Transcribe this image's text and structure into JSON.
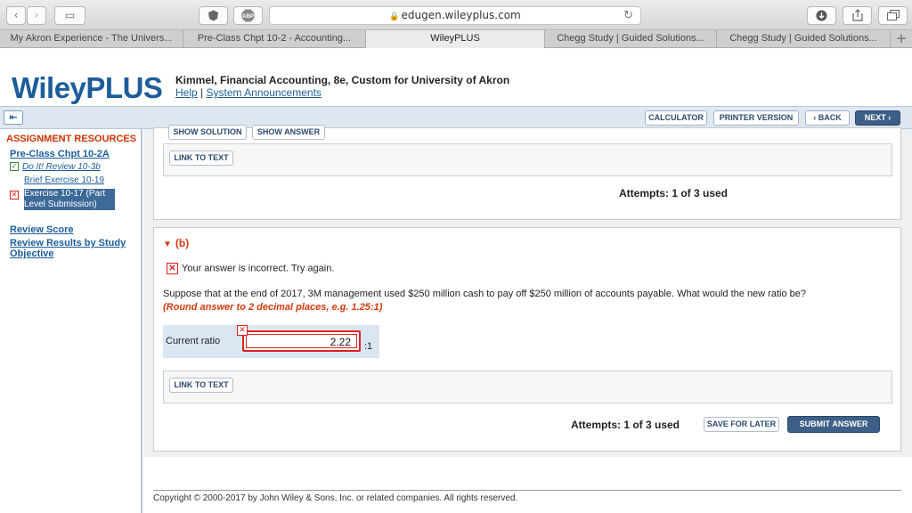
{
  "browser": {
    "url": "edugen.wileyplus.com",
    "tabs": [
      {
        "label": "My Akron Experience - The Univers..."
      },
      {
        "label": "Pre-Class Chpt 10-2 - Accounting..."
      },
      {
        "label": "WileyPLUS"
      },
      {
        "label": "Chegg Study | Guided Solutions..."
      },
      {
        "label": "Chegg Study | Guided Solutions..."
      }
    ],
    "back_icon": "‹",
    "forward_icon": "›",
    "sidebar_icon": "▭",
    "plus": "+"
  },
  "header": {
    "logo": "WileyPLUS",
    "course": "Kimmel, Financial Accounting, 8e, Custom for University of Akron",
    "help": "Help",
    "separator": "|",
    "announcements": "System Announcements"
  },
  "navbar": {
    "calculator": "CALCULATOR",
    "printer": "PRINTER VERSION",
    "back": "‹ BACK",
    "next": "NEXT ›"
  },
  "sidebar": {
    "title": "ASSIGNMENT RESOURCES",
    "section": "Pre-Class Chpt 10-2A",
    "items": [
      {
        "label": "Do It! Review 10-3b",
        "status": "ok"
      },
      {
        "label": "Brief Exercise 10-19",
        "status": "none"
      },
      {
        "label": "Exercise 10-17 (Part Level Submission)",
        "status": "bad"
      }
    ],
    "review_score": "Review Score",
    "review_results": "Review Results by Study Objective"
  },
  "part_a": {
    "show_solution": "SHOW SOLUTION",
    "show_answer": "SHOW ANSWER",
    "link_to_text": "LINK TO TEXT",
    "attempts": "Attempts: 1 of 3 used"
  },
  "part_b": {
    "label": "(b)",
    "feedback": "Your answer is incorrect.  Try again.",
    "question": "Suppose that at the end of 2017, 3M management used $250 million cash to pay off $250 million of accounts payable. What would the new ratio be?",
    "instruction": "(Round answer to 2 decimal places, e.g. 1.25:1)",
    "answer_label": "Current ratio",
    "answer_value": "2.22",
    "answer_suffix": ":1",
    "link_to_text": "LINK TO TEXT",
    "attempts": "Attempts: 1 of 3 used",
    "save_for_later": "SAVE FOR LATER",
    "submit": "SUBMIT ANSWER"
  },
  "footer": {
    "copyright": "Copyright © 2000-2017 by John Wiley & Sons, Inc. or related companies. All rights reserved."
  }
}
